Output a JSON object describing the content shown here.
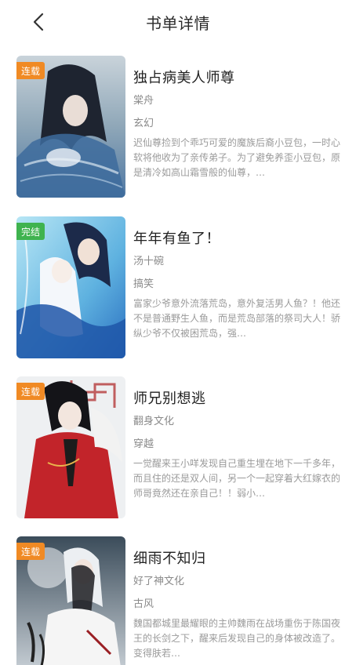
{
  "header": {
    "title": "书单详情",
    "back_icon": "chevron-left-icon"
  },
  "colors": {
    "badge_serial": "#f08a24",
    "badge_finished": "#3fb34f",
    "title_text": "#222222",
    "meta_text": "#8a8a8a"
  },
  "books": [
    {
      "status": "连载",
      "title": "独占病美人师尊",
      "author": "棠舟",
      "genre": "玄幻",
      "description": "迟仙尊捡到个乖巧可爱的魔族后裔小豆包，一时心软将他收为了亲传弟子。为了避免养歪小豆包，原是清冷如高山霜雪般的仙尊，…"
    },
    {
      "status": "完结",
      "title": "年年有鱼了！",
      "author": "汤十碗",
      "genre": "搞笑",
      "description": "富家少爷意外流落荒岛，意外复活男人鱼？！他还不是普通野生人鱼，而是荒岛部落的祭司大人！骄纵少爷不仅被困荒岛，强…"
    },
    {
      "status": "连载",
      "title": "师兄别想逃",
      "author": "翻身文化",
      "genre": "穿越",
      "description": "一觉醒来王小咩发现自己重生埋在地下一千多年，而且住的还是双人间，另一个一起穿着大红嫁衣的师哥竟然还在亲自己！！弱小…"
    },
    {
      "status": "连载",
      "title": "细雨不知归",
      "author": "好了神文化",
      "genre": "古风",
      "description": "魏国都城里最耀眼的主帅魏雨在战场重伤于陈国夜王的长剑之下，醒来后发现自己的身体被改造了。变得肤若…"
    }
  ]
}
